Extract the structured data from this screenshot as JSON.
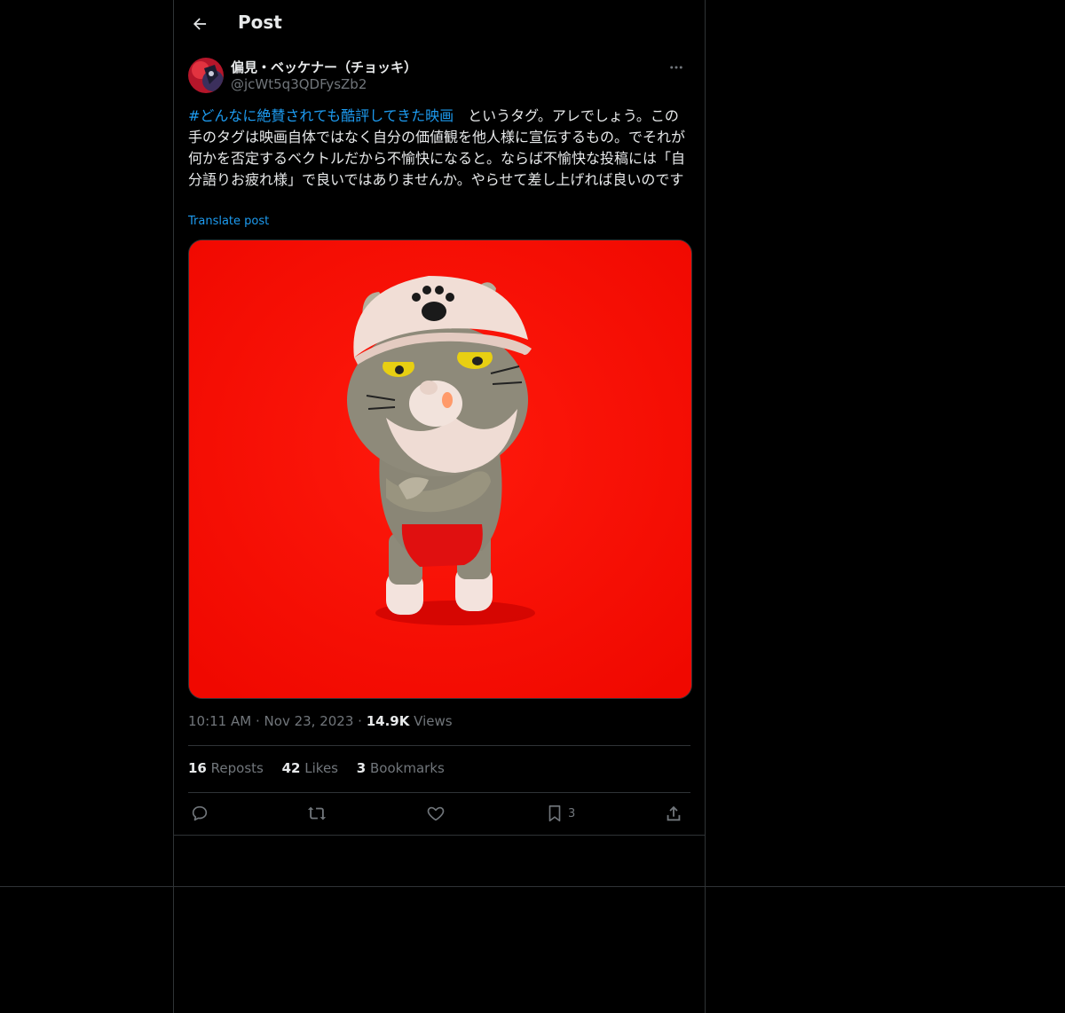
{
  "header": {
    "title": "Post"
  },
  "post": {
    "author_name": "偏見・ベッケナー（チョッキ）",
    "author_handle": "@jcWt5q3QDFysZb2",
    "hashtag": "#どんなに絶賛されても酷評してきた映画",
    "body": "　というタグ。アレでしょう。この手のタグは映画自体ではなく自分の価値観を他人様に宣伝するもの。でそれが何かを否定するベクトルだから不愉快になると。ならば不愉快な投稿には「自分語りお疲れ様」で良いではありませんか。やらせて差し上げれば良いのです",
    "translate_label": "Translate post",
    "time": "10:11 AM",
    "date": "Nov 23, 2023",
    "views_count": "14.9K",
    "views_label": "Views",
    "dot": "·"
  },
  "stats": {
    "reposts_count": "16",
    "reposts_label": "Reposts",
    "likes_count": "42",
    "likes_label": "Likes",
    "bookmarks_count": "3",
    "bookmarks_label": "Bookmarks"
  },
  "actions": {
    "bookmark_count": "3"
  },
  "icons": {
    "back": "arrow-left-icon",
    "more": "more-icon",
    "reply": "reply-icon",
    "repost": "repost-icon",
    "like": "heart-icon",
    "bookmark": "bookmark-icon",
    "share": "share-icon"
  },
  "colors": {
    "background": "#000000",
    "accent": "#1d9bf0",
    "muted": "#71767b",
    "border": "#2f3336",
    "media_bg": "#ff1208"
  }
}
